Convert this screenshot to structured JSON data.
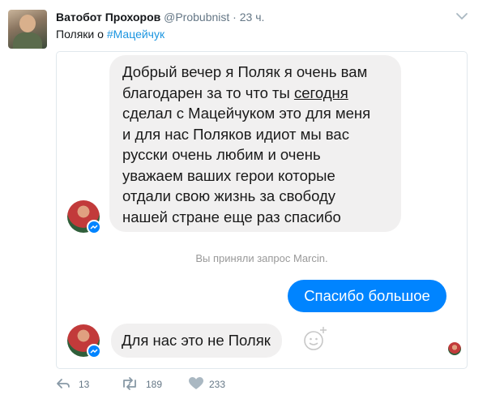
{
  "tweet": {
    "display_name": "Ватобот Прохоров",
    "handle": "@Probubnist",
    "separator": "·",
    "time": "23 ч.",
    "text_prefix": "Поляки о ",
    "hashtag": "#Мацейчук"
  },
  "messenger": {
    "message_1_lines": [
      "Добрый вечер я Поляк я очень вам",
      "благодарен за то что ты ",
      "сегодня",
      "сделал с Мацейчуком это для меня",
      "и для нас Поляков идиот мы вас",
      "русски очень любим и очень",
      "уважаем ваших герои которые",
      "отдали свою жизнь за свободу",
      "нашей стране еще раз спасибо"
    ],
    "system_message": "Вы приняли запрос Marcin.",
    "reply": "Спасибо большое",
    "message_2": "Для нас это не Поляк"
  },
  "actions": {
    "reply_count": "13",
    "retweet_count": "189",
    "like_count": "233"
  },
  "colors": {
    "messenger_blue": "#0084ff",
    "hashtag_blue": "#1b95e0",
    "bubble_grey": "#f1f0f0",
    "muted_text": "#657786"
  }
}
